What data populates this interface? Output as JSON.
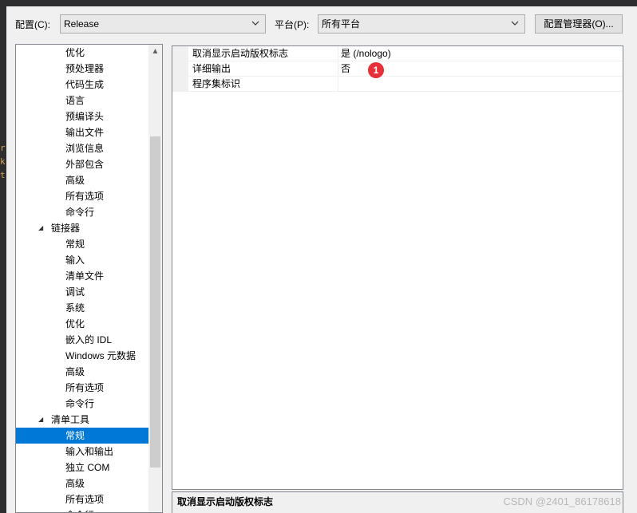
{
  "toolbar": {
    "config_label": "配置(C):",
    "config_value": "Release",
    "platform_label": "平台(P):",
    "platform_value": "所有平台",
    "config_manager_button": "配置管理器(O)..."
  },
  "tree": {
    "items": [
      {
        "label": "优化",
        "level": 2
      },
      {
        "label": "预处理器",
        "level": 2
      },
      {
        "label": "代码生成",
        "level": 2
      },
      {
        "label": "语言",
        "level": 2
      },
      {
        "label": "预编译头",
        "level": 2
      },
      {
        "label": "输出文件",
        "level": 2
      },
      {
        "label": "浏览信息",
        "level": 2
      },
      {
        "label": "外部包含",
        "level": 2
      },
      {
        "label": "高级",
        "level": 2
      },
      {
        "label": "所有选项",
        "level": 2
      },
      {
        "label": "命令行",
        "level": 2
      },
      {
        "label": "链接器",
        "level": 1,
        "expanded": true
      },
      {
        "label": "常规",
        "level": 2
      },
      {
        "label": "输入",
        "level": 2
      },
      {
        "label": "清单文件",
        "level": 2
      },
      {
        "label": "调试",
        "level": 2
      },
      {
        "label": "系统",
        "level": 2
      },
      {
        "label": "优化",
        "level": 2
      },
      {
        "label": "嵌入的 IDL",
        "level": 2
      },
      {
        "label": "Windows 元数据",
        "level": 2
      },
      {
        "label": "高级",
        "level": 2
      },
      {
        "label": "所有选项",
        "level": 2
      },
      {
        "label": "命令行",
        "level": 2
      },
      {
        "label": "清单工具",
        "level": 1,
        "expanded": true
      },
      {
        "label": "常规",
        "level": 2,
        "selected": true
      },
      {
        "label": "输入和输出",
        "level": 2
      },
      {
        "label": "独立 COM",
        "level": 2
      },
      {
        "label": "高级",
        "level": 2
      },
      {
        "label": "所有选项",
        "level": 2
      },
      {
        "label": "命令行",
        "level": 2
      }
    ]
  },
  "properties": {
    "rows": [
      {
        "name": "取消显示启动版权标志",
        "value": "是 (/nologo)"
      },
      {
        "name": "详细输出",
        "value": "否"
      },
      {
        "name": "程序集标识",
        "value": ""
      }
    ]
  },
  "annotation": {
    "badge": "1",
    "color": "#e8303a"
  },
  "description": {
    "title": "取消显示启动版权标志"
  },
  "watermark": "CSDN @2401_86178618",
  "left_fragment": {
    "lines": [
      "r",
      "k",
      "t"
    ],
    "color": "#d6a256"
  },
  "colors": {
    "selection": "#0078d7",
    "dialog_bg": "#f0f0f0"
  }
}
